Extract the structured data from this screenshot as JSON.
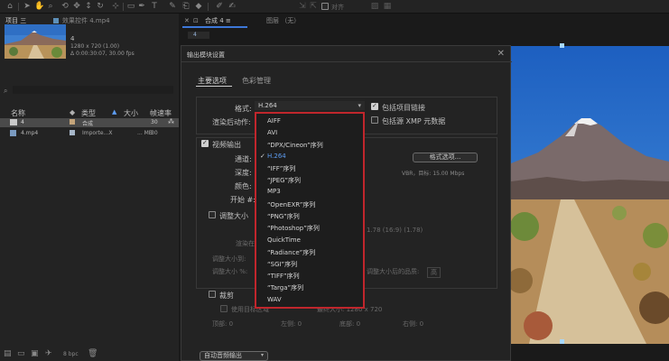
{
  "toolbar": {
    "snap_label": "对齐"
  },
  "project_panel": {
    "tabs": [
      "项目 三",
      "效果控件 4.mp4"
    ],
    "item": {
      "name": "4",
      "dims": "1280 x 720 (1.00)",
      "duration": "Δ 0:00:30:07, 30.00 fps"
    },
    "columns": {
      "name": "名称",
      "type": "类型",
      "size": "大小",
      "framerate": "帧速率"
    },
    "rows": [
      {
        "name": "4",
        "type": "合成",
        "size": "",
        "fps": "30"
      },
      {
        "name": "4.mp4",
        "type": "Importe...X",
        "size": "... MB",
        "fps": "30"
      }
    ],
    "bpc": "8 bpc"
  },
  "comp_panel": {
    "tabs": [
      "合成 4 ≡",
      "图层 （无）"
    ],
    "subtab": "4"
  },
  "dialog": {
    "title": "输出模块设置",
    "tabs": [
      "主要选项",
      "色彩管理"
    ],
    "format_label": "格式:",
    "format_value": "H.264",
    "post_render_label": "渲染后动作:",
    "include_project_link": "包括项目链接",
    "include_xmp": "包括源 XMP 元数据",
    "video_output": "视频输出",
    "channels_label": "通道:",
    "depth_label": "深度:",
    "color_label": "颜色:",
    "start_label": "开始 #:",
    "format_options_button": "格式选项...",
    "vbr_text": "VBR，目标: 15.00 Mbps",
    "resize_label": "调整大小",
    "render_at": "渲染在:",
    "resize_to": "调整大小到:",
    "resize_pct": "调整大小 %:",
    "aspect": "1.78 (16:9) (1.78)",
    "resize_quality": "调整大小后的品质:",
    "quality_value": "高",
    "crop_label": "裁剪",
    "use_roi": "使用目标区域",
    "final_size": "最终大小: 1280 x 720",
    "crop_top": "顶部: 0",
    "crop_left": "左侧: 0",
    "crop_bottom": "底部: 0",
    "crop_right": "右侧: 0",
    "audio_output": "自动音频输出"
  },
  "format_dropdown": {
    "options": [
      "AIFF",
      "AVI",
      "“DPX/Cineon”序列",
      "H.264",
      "“IFF”序列",
      "“JPEG”序列",
      "MP3",
      "“OpenEXR”序列",
      "“PNG”序列",
      "“Photoshop”序列",
      "QuickTime",
      "“Radiance”序列",
      "“SGI”序列",
      "“TIFF”序列",
      "“Targa”序列",
      "WAV"
    ],
    "selected": "H.264"
  },
  "colors": {
    "highlight_border": "#c0262c",
    "selected_item": "#5d9cf0",
    "tab_underline": "#3d78d8"
  }
}
